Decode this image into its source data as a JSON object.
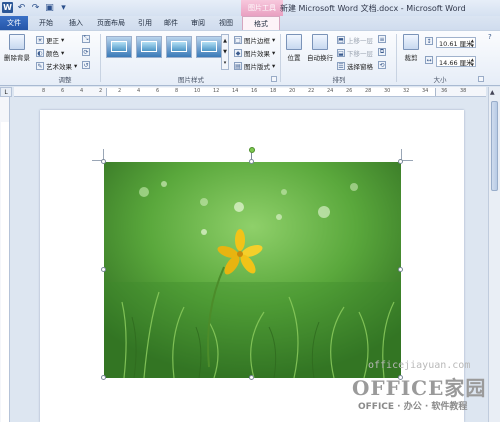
{
  "window": {
    "title": "新建 Microsoft Word 文档.docx - Microsoft Word",
    "contextual_tab_group": "图片工具",
    "app_logo": "W"
  },
  "quick_access": {
    "undo_icon": "undo-icon",
    "redo_icon": "redo-icon",
    "save_icon": "save-icon"
  },
  "tabs": [
    "文件",
    "开始",
    "插入",
    "页面布局",
    "引用",
    "邮件",
    "审阅",
    "视图",
    "格式"
  ],
  "ribbon": {
    "remove_background": "删除背景",
    "adjust": {
      "corrections": "更正",
      "color": "颜色",
      "artistic_effects": "艺术效果",
      "label": "调整"
    },
    "picture_styles": {
      "border": "图片边框",
      "effects": "图片效果",
      "layout": "图片版式",
      "label": "图片样式"
    },
    "arrange": {
      "position": "位置",
      "wrap_text": "自动换行",
      "bring_forward": "上移一层",
      "send_backward": "下移一层",
      "selection_pane": "选择窗格",
      "label": "排列"
    },
    "size": {
      "crop": "裁剪",
      "height": "10.61 厘米",
      "width": "14.66 厘米",
      "label": "大小"
    }
  },
  "ruler": {
    "numbers": [
      "8",
      "6",
      "4",
      "2",
      "2",
      "4",
      "6",
      "8",
      "10",
      "12",
      "14",
      "16",
      "18",
      "20",
      "22",
      "24",
      "26",
      "28",
      "30",
      "32",
      "34",
      "36",
      "38"
    ]
  },
  "watermark": {
    "url": "officejiayuan.com",
    "logo": "OFFICE家园",
    "sub": "OFFICE · 办公 · 软件教程"
  },
  "colors": {
    "file_tab": "#2b5797",
    "contextual": "#e9a0c1",
    "grass": "#4a9a34",
    "flower": "#f2c318"
  }
}
